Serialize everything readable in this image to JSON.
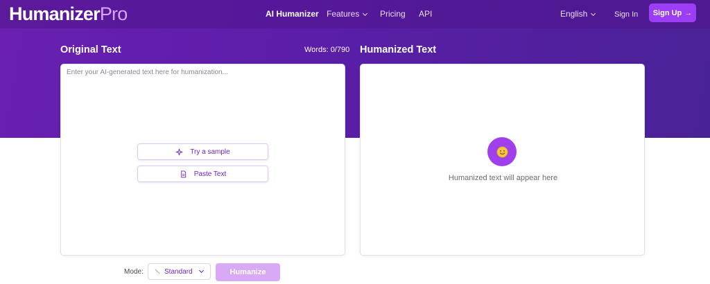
{
  "brand": {
    "name_part1": "Humanizer",
    "name_part2": "Pro"
  },
  "nav": {
    "ai_humanizer": "AI Humanizer",
    "features": "Features",
    "pricing": "Pricing",
    "api": "API",
    "language": "English",
    "sign_in": "Sign In",
    "sign_up": "Sign Up"
  },
  "original": {
    "title": "Original Text",
    "words": "Words: 0/790",
    "placeholder": "Enter your AI-generated text here for humanization...",
    "try_sample": "Try a sample",
    "paste_text": "Paste Text"
  },
  "humanized": {
    "title": "Humanized Text",
    "empty_message": "Humanized text will appear here"
  },
  "controls": {
    "mode_label": "Mode:",
    "mode_value": "Standard",
    "humanize_button": "Humanize"
  },
  "colors": {
    "primary": "#9b3df2",
    "hero": "#5a1ea8",
    "accent_text": "#6b24c4",
    "disabled_button": "#d8aaf5"
  }
}
